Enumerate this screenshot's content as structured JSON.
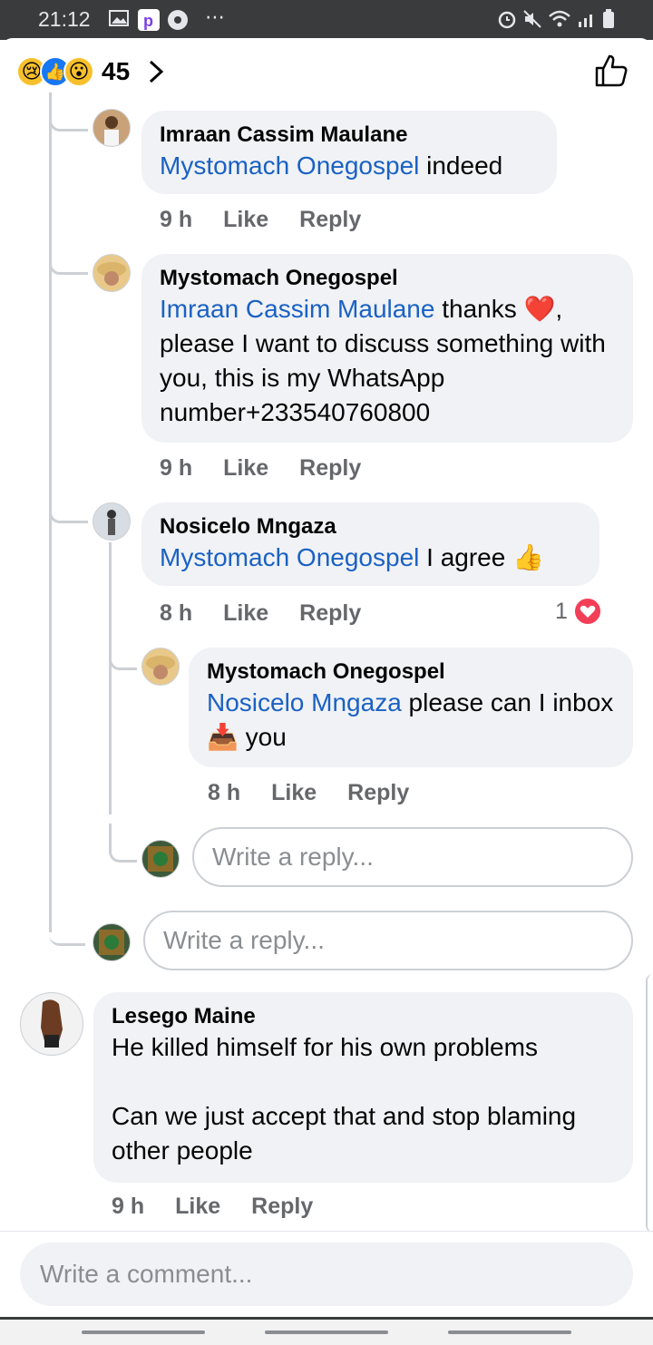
{
  "status_bar": {
    "time": "21:12"
  },
  "header": {
    "reaction_icons": [
      "sad-emoji-icon",
      "like-reaction-icon",
      "wow-emoji-icon"
    ],
    "reaction_count": "45"
  },
  "comments": [
    {
      "author": "Imraan Cassim Maulane",
      "mention": "Mystomach Onegospel",
      "text": " indeed",
      "time": "9 h",
      "like": "Like",
      "reply": "Reply"
    },
    {
      "author": "Mystomach Onegospel",
      "mention": "Imraan Cassim Maulane",
      "text": " thanks ❤️, please I want to discuss something with you, this is my WhatsApp number+233540760800",
      "time": "9 h",
      "like": "Like",
      "reply": "Reply"
    },
    {
      "author": "Nosicelo Mngaza",
      "mention": "Mystomach Onegospel",
      "text": " I agree 👍",
      "time": "8 h",
      "like": "Like",
      "reply": "Reply",
      "reaction_count": "1"
    },
    {
      "author": "Mystomach Onegospel",
      "mention": "Nosicelo Mngaza",
      "text": " please can I inbox 📥 you",
      "time": "8 h",
      "like": "Like",
      "reply": "Reply"
    },
    {
      "author": "Lesego Maine",
      "mention": "",
      "text": "He killed himself for his own problems\n\nCan we just accept that and stop blaming other people",
      "time": "9 h",
      "like": "Like",
      "reply": "Reply"
    }
  ],
  "reply_placeholder": "Write a reply...",
  "comment_placeholder": "Write a comment...",
  "colors": {
    "mention": "#1a61c4",
    "bubble": "#f0f2f5",
    "meta": "#65676b",
    "heart": "#f33e58"
  }
}
